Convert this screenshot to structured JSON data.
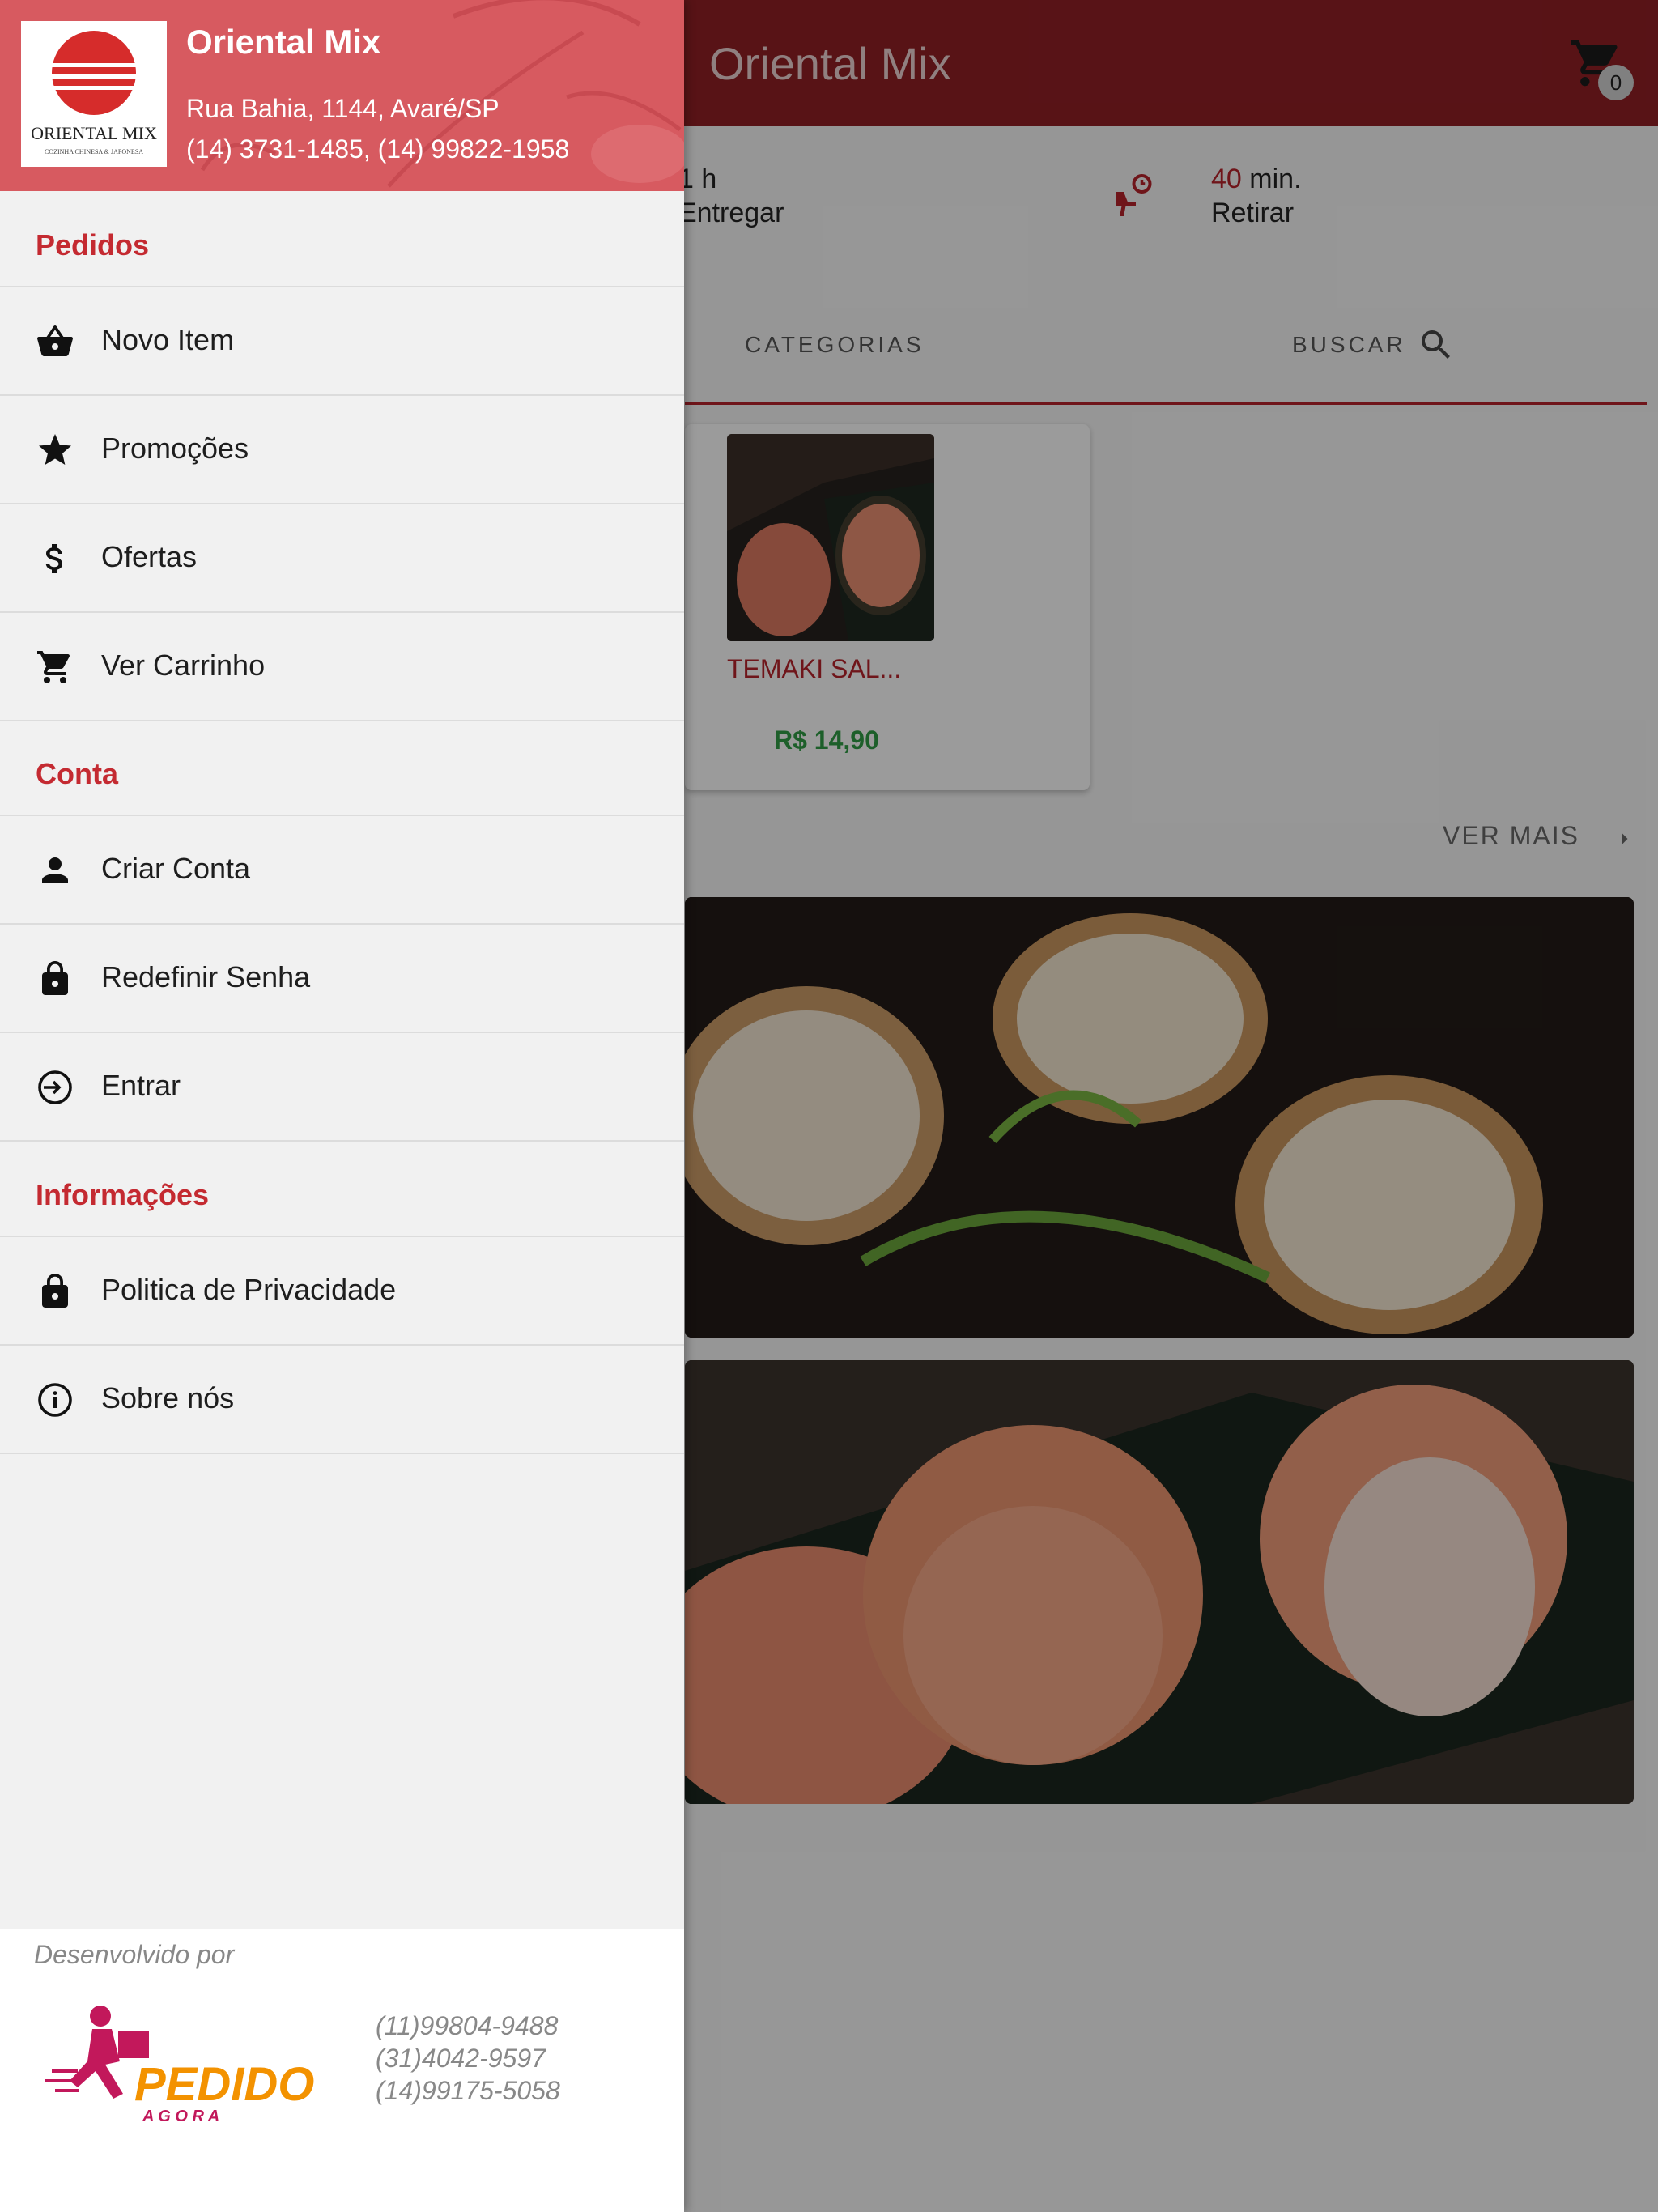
{
  "appbar": {
    "title": "Oriental Mix",
    "cart_count": "0"
  },
  "info": {
    "delivery_time": "1 h",
    "delivery_label": "Entregar",
    "pickup_value": "40",
    "pickup_unit": "min.",
    "pickup_label": "Retirar"
  },
  "tabs": {
    "categories": "CATEGORIAS",
    "search": "BUSCAR"
  },
  "product": {
    "name": "TEMAKI SAL...",
    "price": "R$ 14,90"
  },
  "more": {
    "label": "VER MAIS"
  },
  "drawer": {
    "store_name": "Oriental Mix",
    "logo_text": "ORIENTAL MIX",
    "logo_sub": "COZINHA CHINESA & JAPONESA",
    "address": "Rua Bahia, 1144, Avaré/SP",
    "phones": "(14) 3731-1485, (14) 99822-1958",
    "sections": {
      "orders": "Pedidos",
      "account": "Conta",
      "info": "Informações"
    },
    "items": {
      "new_item": "Novo Item",
      "promotions": "Promoções",
      "offers": "Ofertas",
      "cart": "Ver Carrinho",
      "create_account": "Criar Conta",
      "reset_password": "Redefinir Senha",
      "login": "Entrar",
      "privacy": "Politica de Privacidade",
      "about": "Sobre nós"
    },
    "footer": {
      "developed_by": "Desenvolvido por",
      "brand": "PEDIDO",
      "brand_sub": "A G O R A",
      "phone1": "(11)99804-9488",
      "phone2": "(31)4042-9597",
      "phone3": "(14)99175-5058"
    }
  },
  "colors": {
    "brand_dark": "#8e1f25",
    "header_red": "#d75a60",
    "section_red": "#c42a31",
    "price_green": "#2f9a44"
  }
}
